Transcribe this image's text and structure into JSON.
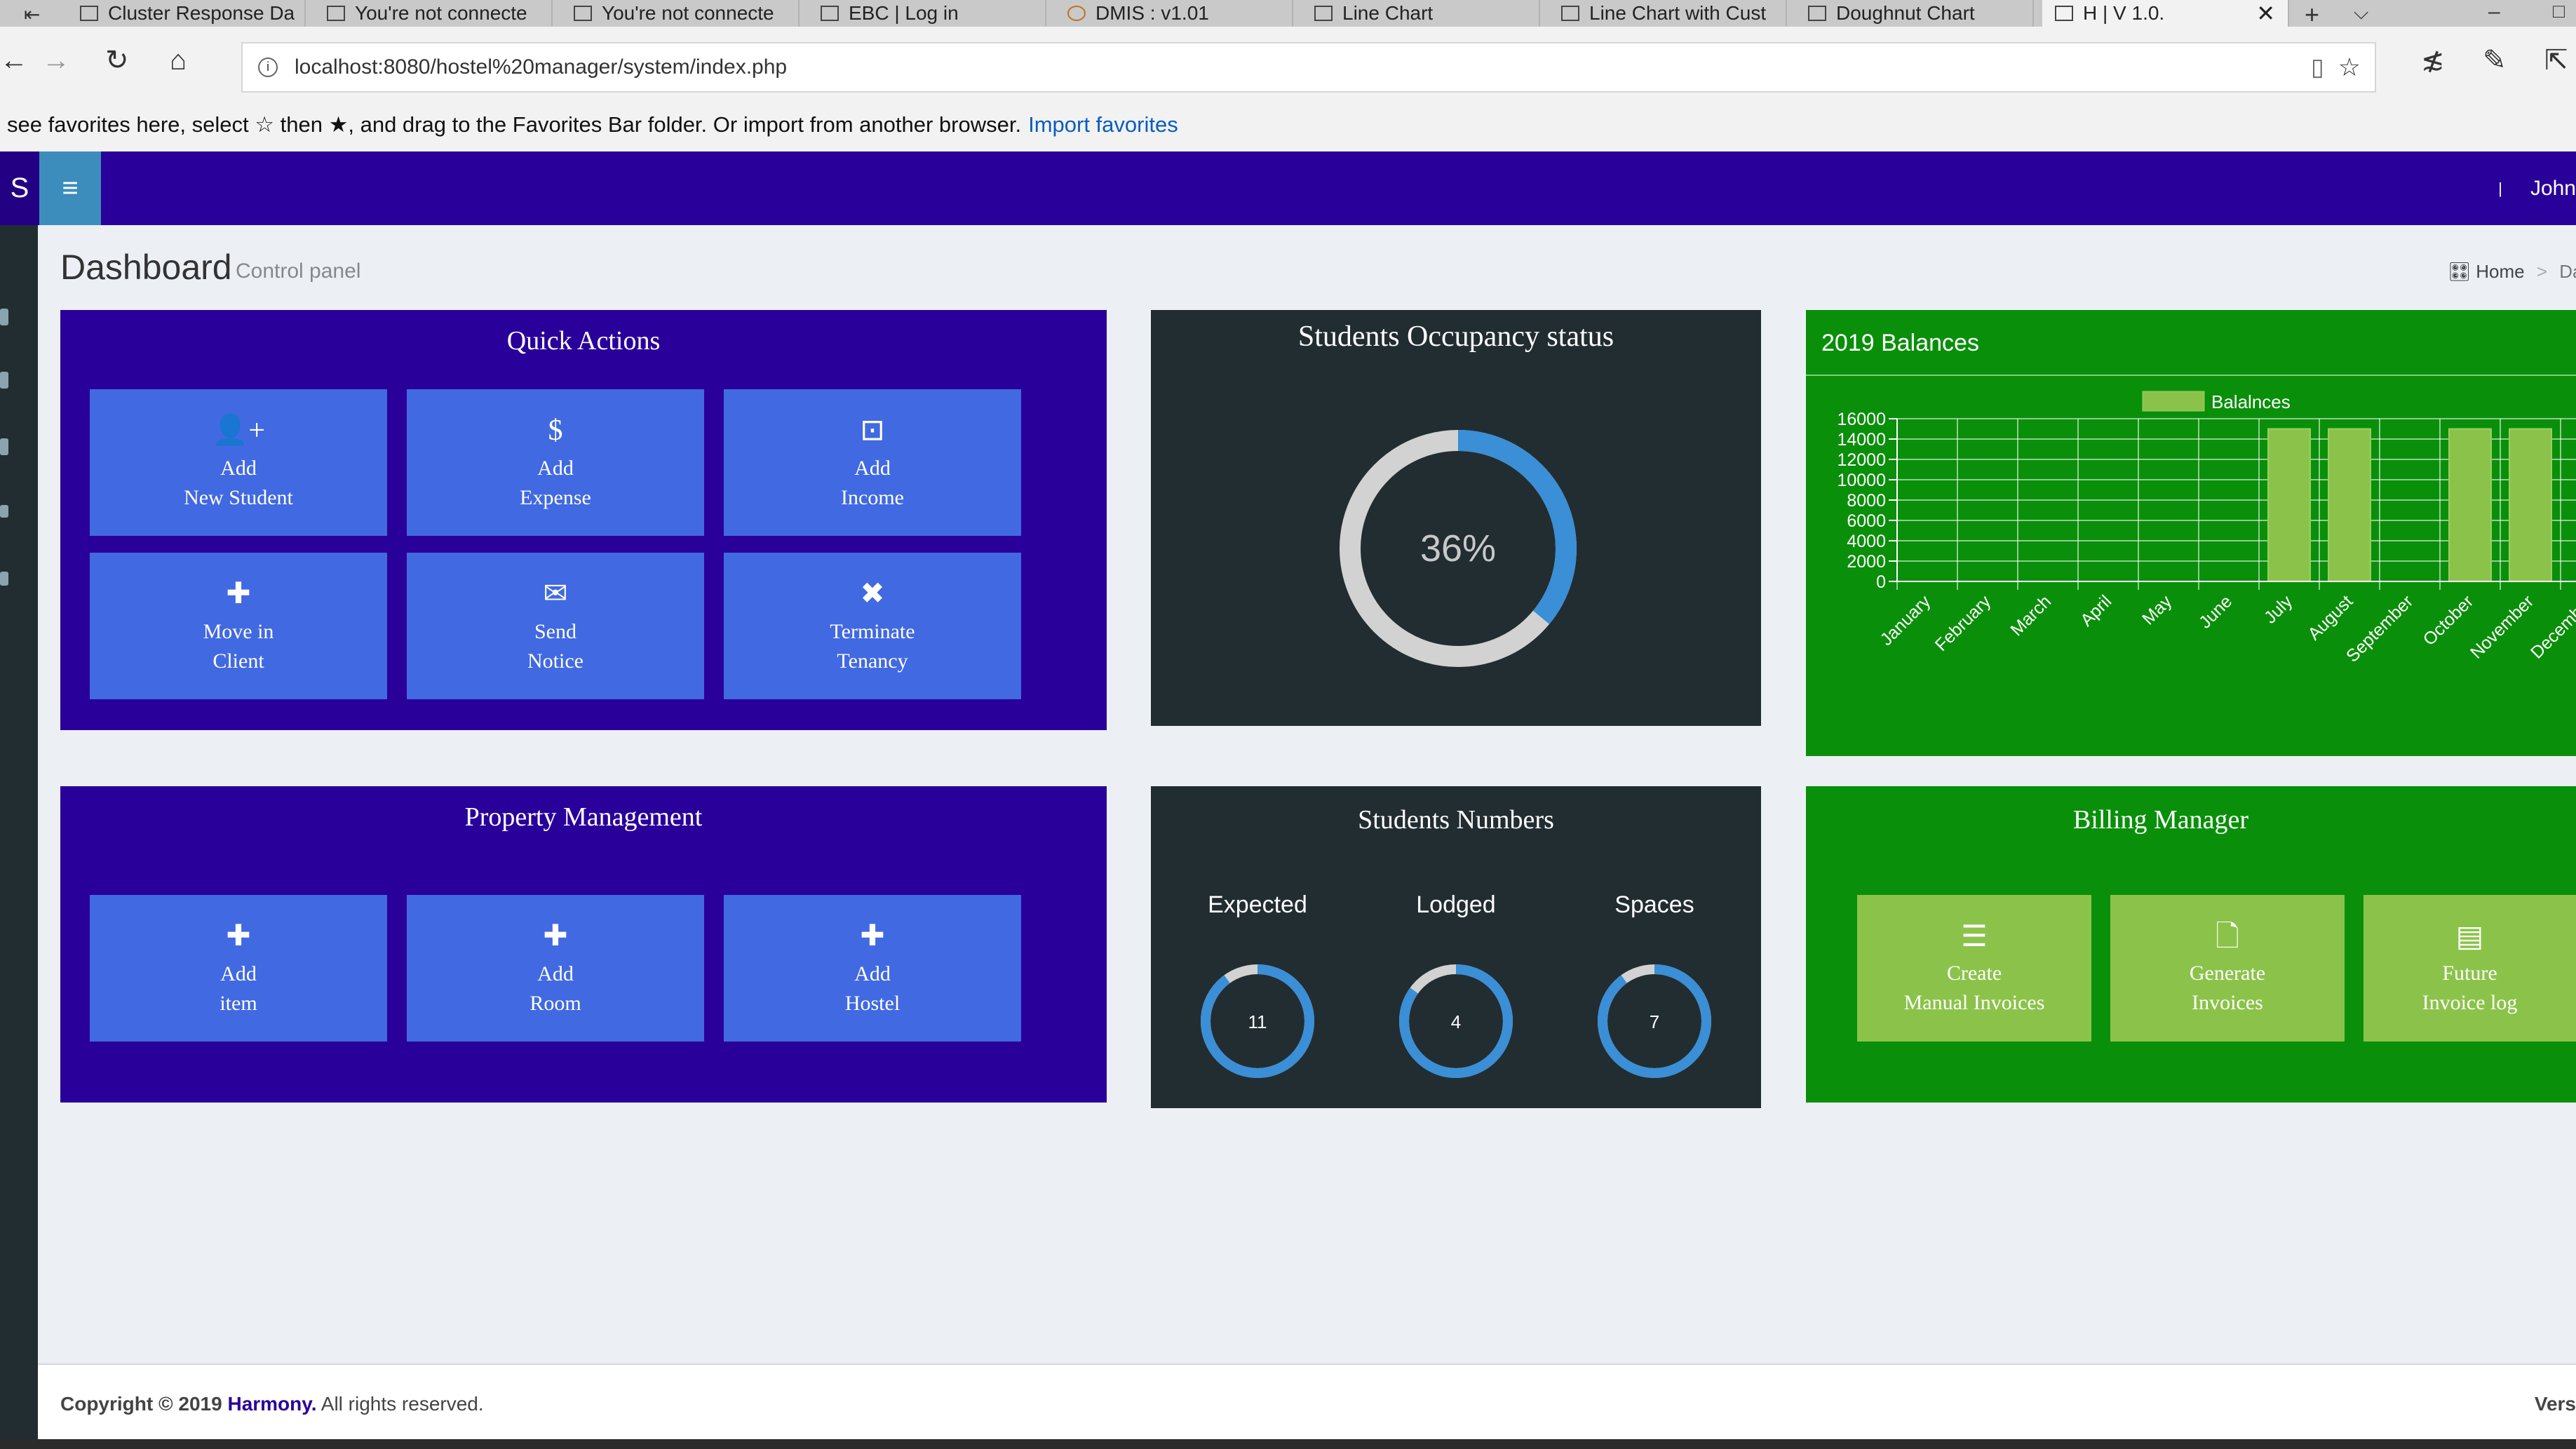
{
  "browser": {
    "tabs": [
      {
        "title": "Cluster Response Da"
      },
      {
        "title": "You're not connecte"
      },
      {
        "title": "You're not connecte"
      },
      {
        "title": "EBC | Log in"
      },
      {
        "title": "DMIS : v1.01"
      },
      {
        "title": "Line Chart"
      },
      {
        "title": "Line Chart with Cust"
      },
      {
        "title": "Doughnut Chart"
      },
      {
        "title": "H | V 1.0."
      }
    ],
    "url": "localhost:8080/hostel%20manager/system/index.php",
    "favorites_hint": "see favorites here, select ☆ then ★, and drag to the Favorites Bar folder. Or import from another browser.",
    "import_link": "Import favorites"
  },
  "header": {
    "logo": "S",
    "menu_icon": "hamburger-icon",
    "user_name": "John"
  },
  "page": {
    "title": "Dashboard",
    "subtitle": "Control panel",
    "breadcrumb_home": "Home",
    "breadcrumb_current": "Das"
  },
  "quick_actions": {
    "title": "Quick Actions",
    "buttons": [
      {
        "icon": "user-plus-icon",
        "line1": "Add",
        "line2": "New Student"
      },
      {
        "icon": "dollar-icon",
        "line1": "Add",
        "line2": "Expense"
      },
      {
        "icon": "money-icon",
        "line1": "Add",
        "line2": "Income"
      },
      {
        "icon": "plus-icon",
        "line1": "Move in",
        "line2": "Client"
      },
      {
        "icon": "envelope-icon",
        "line1": "Send",
        "line2": "Notice"
      },
      {
        "icon": "times-icon",
        "line1": "Terminate",
        "line2": "Tenancy"
      }
    ]
  },
  "occupancy": {
    "title": "Students Occupancy status",
    "percent_label": "36%",
    "percent": 36
  },
  "balances": {
    "title": "2019 Balances"
  },
  "chart_data": {
    "type": "bar",
    "categories": [
      "January",
      "February",
      "March",
      "April",
      "May",
      "June",
      "July",
      "August",
      "September",
      "October",
      "November",
      "December"
    ],
    "series": [
      {
        "name": "Balalnces",
        "values": [
          0,
          0,
          0,
          0,
          0,
          0,
          15000,
          15000,
          0,
          15000,
          15000,
          0
        ]
      }
    ],
    "y_ticks": [
      0,
      2000,
      4000,
      6000,
      8000,
      10000,
      12000,
      14000,
      16000
    ],
    "ylim": [
      0,
      16000
    ],
    "legend": "top",
    "grid": true,
    "colors": {
      "bar": "#8bc34a",
      "bar_border": "#9ccc65"
    }
  },
  "property": {
    "title": "Property Management",
    "buttons": [
      {
        "icon": "plus-icon",
        "line1": "Add",
        "line2": "item"
      },
      {
        "icon": "plus-icon",
        "line1": "Add",
        "line2": "Room"
      },
      {
        "icon": "plus-icon",
        "line1": "Add",
        "line2": "Hostel"
      }
    ]
  },
  "students_numbers": {
    "title": "Students Numbers",
    "items": [
      {
        "label": "Expected",
        "value": "11",
        "fraction": 0.9
      },
      {
        "label": "Lodged",
        "value": "4",
        "fraction": 0.85
      },
      {
        "label": "Spaces",
        "value": "7",
        "fraction": 0.9
      }
    ]
  },
  "billing": {
    "title": "Billing Manager",
    "buttons": [
      {
        "icon": "list-icon",
        "line1": "Create",
        "line2": "Manual Invoices"
      },
      {
        "icon": "file-icon",
        "line1": "Generate",
        "line2": "Invoices"
      },
      {
        "icon": "log-icon",
        "line1": "Future",
        "line2": "Invoice log"
      }
    ]
  },
  "footer": {
    "copyright": "Copyright © 2019",
    "brand": "Harmony.",
    "rights": "All rights reserved.",
    "version": "Vers"
  },
  "colors": {
    "header": "#2a009a",
    "panel_blue": "#2a009a",
    "panel_dark": "#222d32",
    "panel_green": "#0a8f0a",
    "tile_blue": "#4169e1",
    "tile_green": "#8bc34a",
    "ring_blue": "#3a8fd6"
  }
}
